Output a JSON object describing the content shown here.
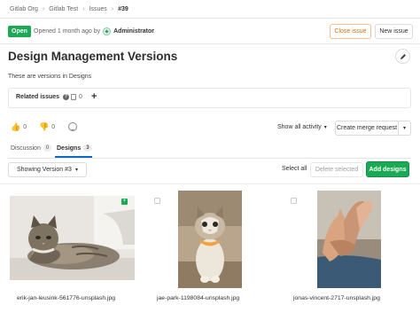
{
  "breadcrumb": [
    "Gitlab Org",
    "Gitlab Test",
    "Issues",
    "#39"
  ],
  "header": {
    "status": "Open",
    "opened_text": "Opened 1 month ago by",
    "author": "Administrator",
    "close_label": "Close issue",
    "new_label": "New issue"
  },
  "issue": {
    "title": "Design Management Versions",
    "description": "These are versions in Designs"
  },
  "related": {
    "label": "Related issues",
    "count": "0",
    "add_symbol": "+"
  },
  "reactions": {
    "thumbs_up_count": "0",
    "thumbs_down_count": "0"
  },
  "activity": {
    "filter_label": "Show all activity",
    "merge_request_label": "Create merge request"
  },
  "tabs": [
    {
      "label": "Discussion",
      "count": "0"
    },
    {
      "label": "Designs",
      "count": "3"
    }
  ],
  "designs": {
    "version_label": "Showing Version #3",
    "select_all_label": "Select all",
    "delete_label": "Delete selected",
    "add_label": "Add designs",
    "items": [
      {
        "filename": "erik-jan-leusink-561776-unsplash.jpg"
      },
      {
        "filename": "jae-park-1198084-unsplash.jpg"
      },
      {
        "filename": "jonas-vincent-2717-unsplash.jpg"
      }
    ]
  },
  "icons": {
    "crumb_separator": "chevron-right-icon",
    "edit": "pencil-icon",
    "help": "question-icon",
    "issues": "issues-icon",
    "thumbs_up": "thumbs-up-icon",
    "thumbs_down": "thumbs-down-icon",
    "emoji": "smiley-icon",
    "dropdown": "chevron-down-icon",
    "new_design": "plus-icon"
  },
  "colors": {
    "success": "#1aaa55",
    "warning_text": "#d1700a",
    "warning_border": "#f1c08a",
    "tab_active": "#1068bf"
  }
}
